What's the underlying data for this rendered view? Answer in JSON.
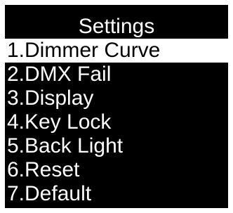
{
  "screen": {
    "title": "Settings",
    "selected_index": 0
  },
  "menu": {
    "items": [
      {
        "label": "1.Dimmer Curve"
      },
      {
        "label": "2.DMX Fail"
      },
      {
        "label": "3.Display"
      },
      {
        "label": "4.Key Lock"
      },
      {
        "label": "5.Back Light"
      },
      {
        "label": "6.Reset"
      },
      {
        "label": "7.Default"
      }
    ]
  },
  "colors": {
    "background": "#000000",
    "text": "#ffffff",
    "highlight": "#ffffff",
    "highlight_text": "#000000"
  }
}
